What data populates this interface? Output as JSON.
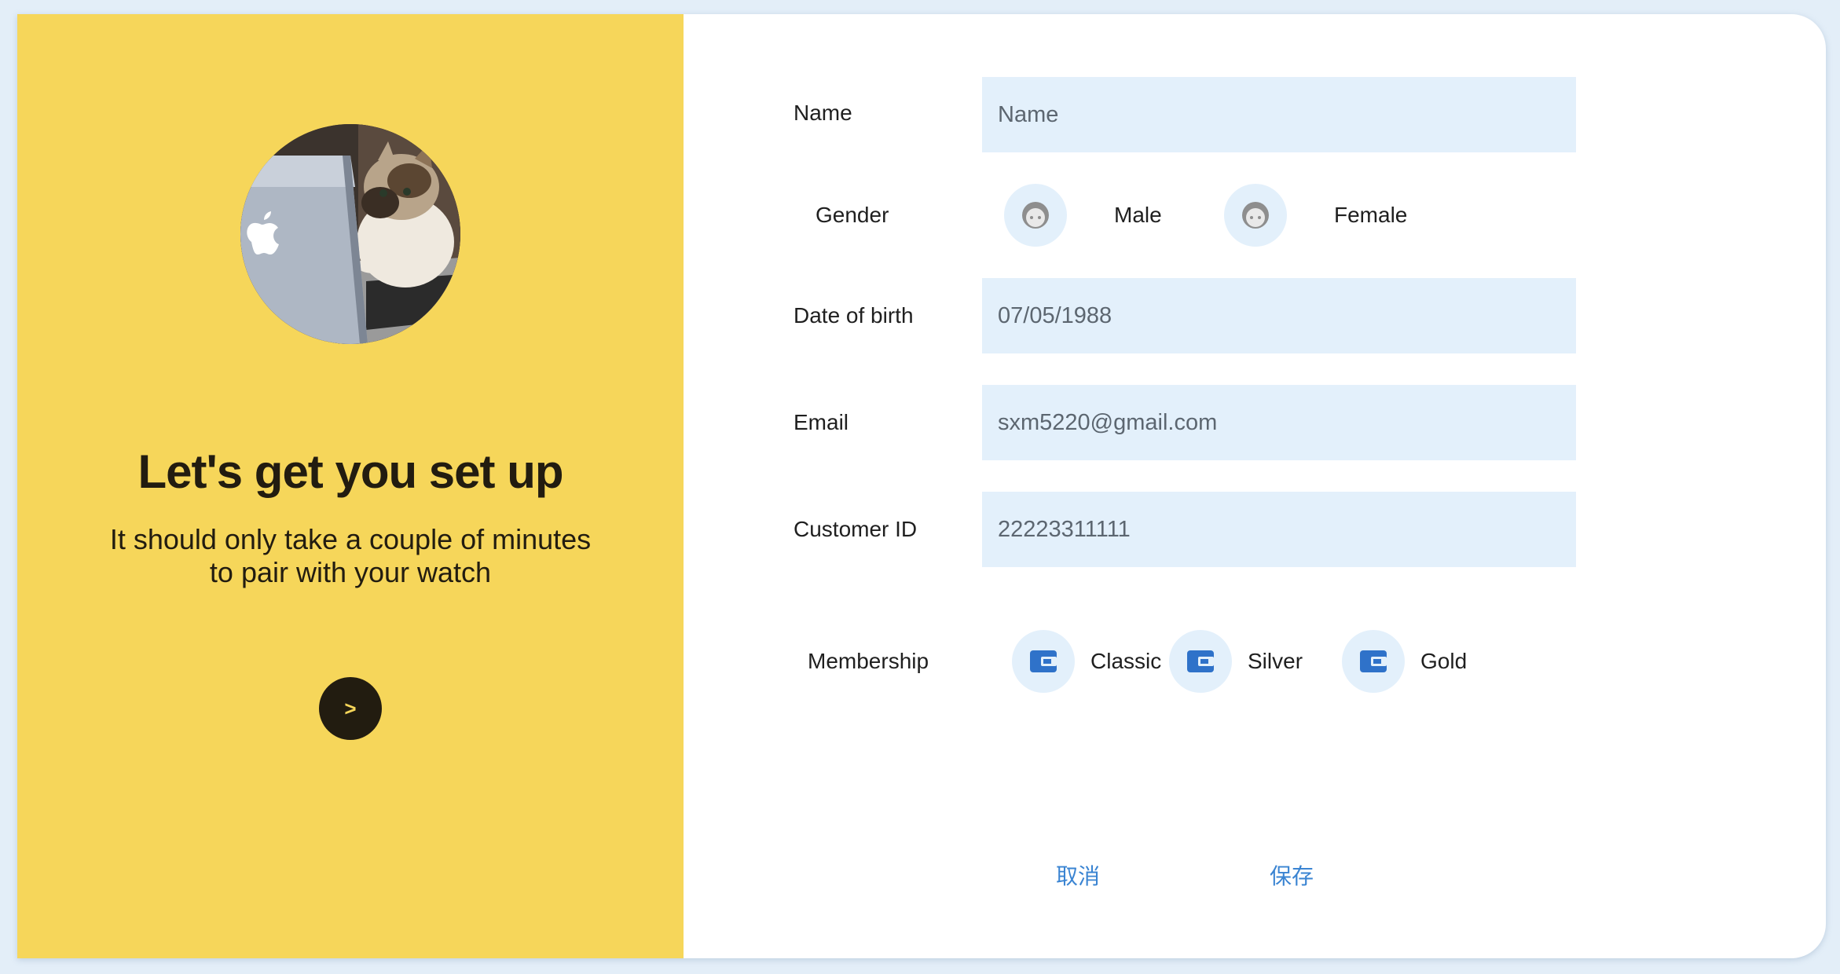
{
  "left_panel": {
    "headline": "Let's get you set up",
    "subline_line1": "It should only take a couple of minutes",
    "subline_line2": "to pair with your watch",
    "next_button": ">",
    "avatar_icon": "cat-laptop-photo"
  },
  "form": {
    "name": {
      "label": "Name",
      "value": "",
      "placeholder": "Name"
    },
    "gender": {
      "label": "Gender",
      "options": [
        {
          "label": "Male",
          "icon": "face-icon"
        },
        {
          "label": "Female",
          "icon": "face-icon"
        }
      ]
    },
    "dob": {
      "label": "Date of birth",
      "value": "07/05/1988"
    },
    "email": {
      "label": "Email",
      "value": "sxm5220@gmail.com"
    },
    "customer_id": {
      "label": "Customer ID",
      "value": "22223311111"
    },
    "membership": {
      "label": "Membership",
      "options": [
        {
          "label": "Classic",
          "icon": "wallet-icon"
        },
        {
          "label": "Silver",
          "icon": "wallet-icon"
        },
        {
          "label": "Gold",
          "icon": "wallet-icon"
        }
      ]
    }
  },
  "actions": {
    "cancel": "取消",
    "save": "保存"
  },
  "colors": {
    "accent_yellow": "#f6d65a",
    "field_bg": "#e3f0fb",
    "icon_blue": "#2f72c9",
    "action_blue": "#3a84d2",
    "dark": "#221c10"
  }
}
